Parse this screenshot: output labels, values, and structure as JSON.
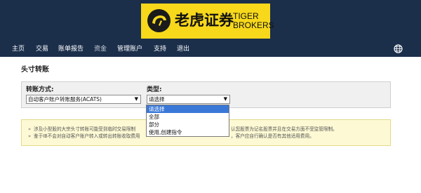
{
  "header": {
    "logo": {
      "cn": "老虎证券",
      "en1": "TIGER",
      "en2": "BROKERS"
    },
    "nav": [
      "主页",
      "交易",
      "账单报告",
      "资金",
      "管理账户",
      "支持",
      "退出"
    ],
    "active_nav": "资金",
    "globe_icon": "globe-icon"
  },
  "page": {
    "title": "头寸转账"
  },
  "form": {
    "method_label": "转账方式:",
    "method_value": "自动客户账户转账服务(ACATS)",
    "type_label": "类型:",
    "type_value": "请选择"
  },
  "dropdown": {
    "options": [
      "请选择",
      "全部",
      "部分",
      "使用,创建指令"
    ],
    "highlighted": "请选择"
  },
  "notice": {
    "line1_left": "涉及小型股的大宗头寸转账可能受到临时交易限制",
    "line1_right": "认您股票为记名股票并且在交易方面不受监管限制。",
    "line2_left": "鉴于IB不会对自动客户账户转入或转出转账收取费用",
    "line2_right": "，客户应自行确认是否有其他适用费用。"
  },
  "colors": {
    "header_bg": "#1b2f4b",
    "logo_bg": "#f7d81b",
    "highlight": "#3a78d8",
    "notice_bg": "#fdf9d4"
  }
}
